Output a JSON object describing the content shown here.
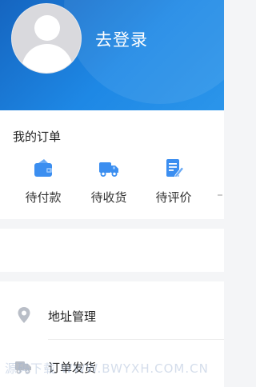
{
  "header": {
    "login_text": "去登录"
  },
  "orders": {
    "title": "我的订单",
    "items": [
      {
        "label": "待付款",
        "icon": "wallet-icon"
      },
      {
        "label": "待收货",
        "icon": "truck-icon"
      },
      {
        "label": "待评价",
        "icon": "review-edit-icon"
      }
    ]
  },
  "menu": {
    "items": [
      {
        "label": "地址管理",
        "icon": "location-pin-icon"
      },
      {
        "label": "订单发货",
        "icon": "delivery-truck-icon"
      }
    ]
  },
  "watermark": {
    "text": "源码下载 WWW.BWYXH.COM.CN"
  },
  "colors": {
    "header_blue": "#1e88e5",
    "icon_blue": "#3b8ef0",
    "menu_icon_gray": "#b9bec7"
  }
}
